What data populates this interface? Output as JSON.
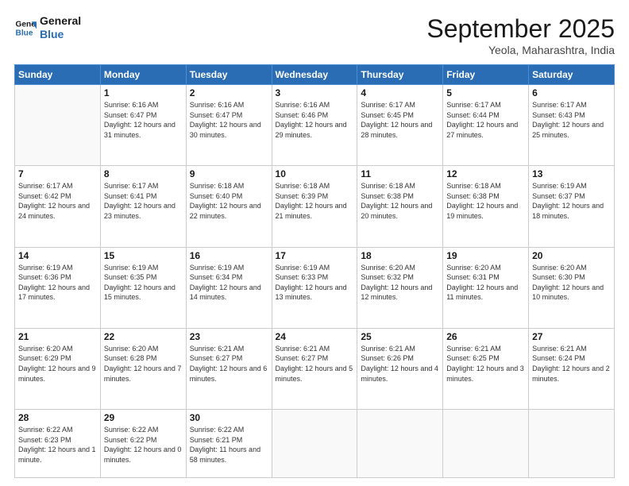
{
  "logo": {
    "line1": "General",
    "line2": "Blue"
  },
  "title": "September 2025",
  "subtitle": "Yeola, Maharashtra, India",
  "days_of_week": [
    "Sunday",
    "Monday",
    "Tuesday",
    "Wednesday",
    "Thursday",
    "Friday",
    "Saturday"
  ],
  "weeks": [
    [
      {
        "day": "",
        "info": ""
      },
      {
        "day": "1",
        "info": "Sunrise: 6:16 AM\nSunset: 6:47 PM\nDaylight: 12 hours and 31 minutes."
      },
      {
        "day": "2",
        "info": "Sunrise: 6:16 AM\nSunset: 6:47 PM\nDaylight: 12 hours and 30 minutes."
      },
      {
        "day": "3",
        "info": "Sunrise: 6:16 AM\nSunset: 6:46 PM\nDaylight: 12 hours and 29 minutes."
      },
      {
        "day": "4",
        "info": "Sunrise: 6:17 AM\nSunset: 6:45 PM\nDaylight: 12 hours and 28 minutes."
      },
      {
        "day": "5",
        "info": "Sunrise: 6:17 AM\nSunset: 6:44 PM\nDaylight: 12 hours and 27 minutes."
      },
      {
        "day": "6",
        "info": "Sunrise: 6:17 AM\nSunset: 6:43 PM\nDaylight: 12 hours and 25 minutes."
      }
    ],
    [
      {
        "day": "7",
        "info": "Sunrise: 6:17 AM\nSunset: 6:42 PM\nDaylight: 12 hours and 24 minutes."
      },
      {
        "day": "8",
        "info": "Sunrise: 6:17 AM\nSunset: 6:41 PM\nDaylight: 12 hours and 23 minutes."
      },
      {
        "day": "9",
        "info": "Sunrise: 6:18 AM\nSunset: 6:40 PM\nDaylight: 12 hours and 22 minutes."
      },
      {
        "day": "10",
        "info": "Sunrise: 6:18 AM\nSunset: 6:39 PM\nDaylight: 12 hours and 21 minutes."
      },
      {
        "day": "11",
        "info": "Sunrise: 6:18 AM\nSunset: 6:38 PM\nDaylight: 12 hours and 20 minutes."
      },
      {
        "day": "12",
        "info": "Sunrise: 6:18 AM\nSunset: 6:38 PM\nDaylight: 12 hours and 19 minutes."
      },
      {
        "day": "13",
        "info": "Sunrise: 6:19 AM\nSunset: 6:37 PM\nDaylight: 12 hours and 18 minutes."
      }
    ],
    [
      {
        "day": "14",
        "info": "Sunrise: 6:19 AM\nSunset: 6:36 PM\nDaylight: 12 hours and 17 minutes."
      },
      {
        "day": "15",
        "info": "Sunrise: 6:19 AM\nSunset: 6:35 PM\nDaylight: 12 hours and 15 minutes."
      },
      {
        "day": "16",
        "info": "Sunrise: 6:19 AM\nSunset: 6:34 PM\nDaylight: 12 hours and 14 minutes."
      },
      {
        "day": "17",
        "info": "Sunrise: 6:19 AM\nSunset: 6:33 PM\nDaylight: 12 hours and 13 minutes."
      },
      {
        "day": "18",
        "info": "Sunrise: 6:20 AM\nSunset: 6:32 PM\nDaylight: 12 hours and 12 minutes."
      },
      {
        "day": "19",
        "info": "Sunrise: 6:20 AM\nSunset: 6:31 PM\nDaylight: 12 hours and 11 minutes."
      },
      {
        "day": "20",
        "info": "Sunrise: 6:20 AM\nSunset: 6:30 PM\nDaylight: 12 hours and 10 minutes."
      }
    ],
    [
      {
        "day": "21",
        "info": "Sunrise: 6:20 AM\nSunset: 6:29 PM\nDaylight: 12 hours and 9 minutes."
      },
      {
        "day": "22",
        "info": "Sunrise: 6:20 AM\nSunset: 6:28 PM\nDaylight: 12 hours and 7 minutes."
      },
      {
        "day": "23",
        "info": "Sunrise: 6:21 AM\nSunset: 6:27 PM\nDaylight: 12 hours and 6 minutes."
      },
      {
        "day": "24",
        "info": "Sunrise: 6:21 AM\nSunset: 6:27 PM\nDaylight: 12 hours and 5 minutes."
      },
      {
        "day": "25",
        "info": "Sunrise: 6:21 AM\nSunset: 6:26 PM\nDaylight: 12 hours and 4 minutes."
      },
      {
        "day": "26",
        "info": "Sunrise: 6:21 AM\nSunset: 6:25 PM\nDaylight: 12 hours and 3 minutes."
      },
      {
        "day": "27",
        "info": "Sunrise: 6:21 AM\nSunset: 6:24 PM\nDaylight: 12 hours and 2 minutes."
      }
    ],
    [
      {
        "day": "28",
        "info": "Sunrise: 6:22 AM\nSunset: 6:23 PM\nDaylight: 12 hours and 1 minute."
      },
      {
        "day": "29",
        "info": "Sunrise: 6:22 AM\nSunset: 6:22 PM\nDaylight: 12 hours and 0 minutes."
      },
      {
        "day": "30",
        "info": "Sunrise: 6:22 AM\nSunset: 6:21 PM\nDaylight: 11 hours and 58 minutes."
      },
      {
        "day": "",
        "info": ""
      },
      {
        "day": "",
        "info": ""
      },
      {
        "day": "",
        "info": ""
      },
      {
        "day": "",
        "info": ""
      }
    ]
  ]
}
